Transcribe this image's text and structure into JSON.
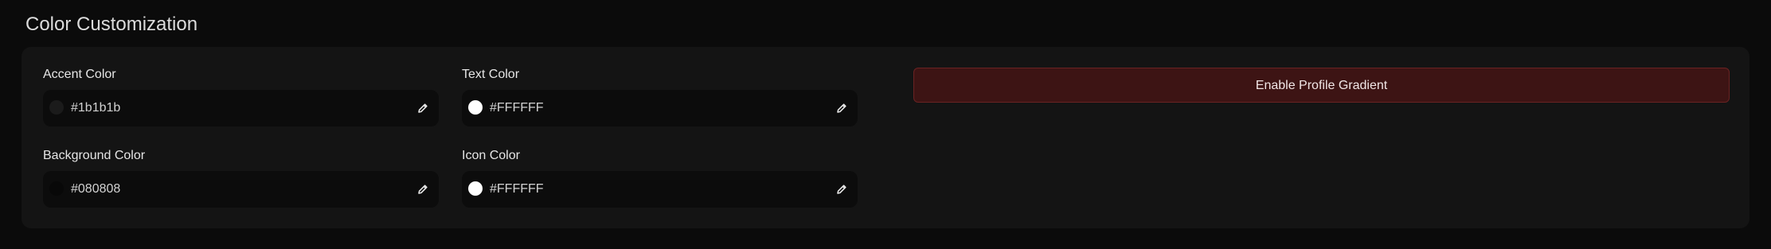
{
  "section": {
    "title": "Color Customization"
  },
  "fields": [
    {
      "label": "Accent Color",
      "value": "#1b1b1b",
      "swatch_color": "#1b1b1b",
      "edit_icon": "pencil-icon"
    },
    {
      "label": "Text Color",
      "value": "#FFFFFF",
      "swatch_color": "#FFFFFF",
      "edit_icon": "pencil-icon"
    },
    {
      "label": "Background Color",
      "value": "#080808",
      "swatch_color": "#080808",
      "edit_icon": "pencil-icon"
    },
    {
      "label": "Icon Color",
      "value": "#FFFFFF",
      "swatch_color": "#FFFFFF",
      "edit_icon": "pencil-icon"
    }
  ],
  "gradient_button": {
    "label": "Enable Profile Gradient",
    "color": "#3d1414"
  }
}
